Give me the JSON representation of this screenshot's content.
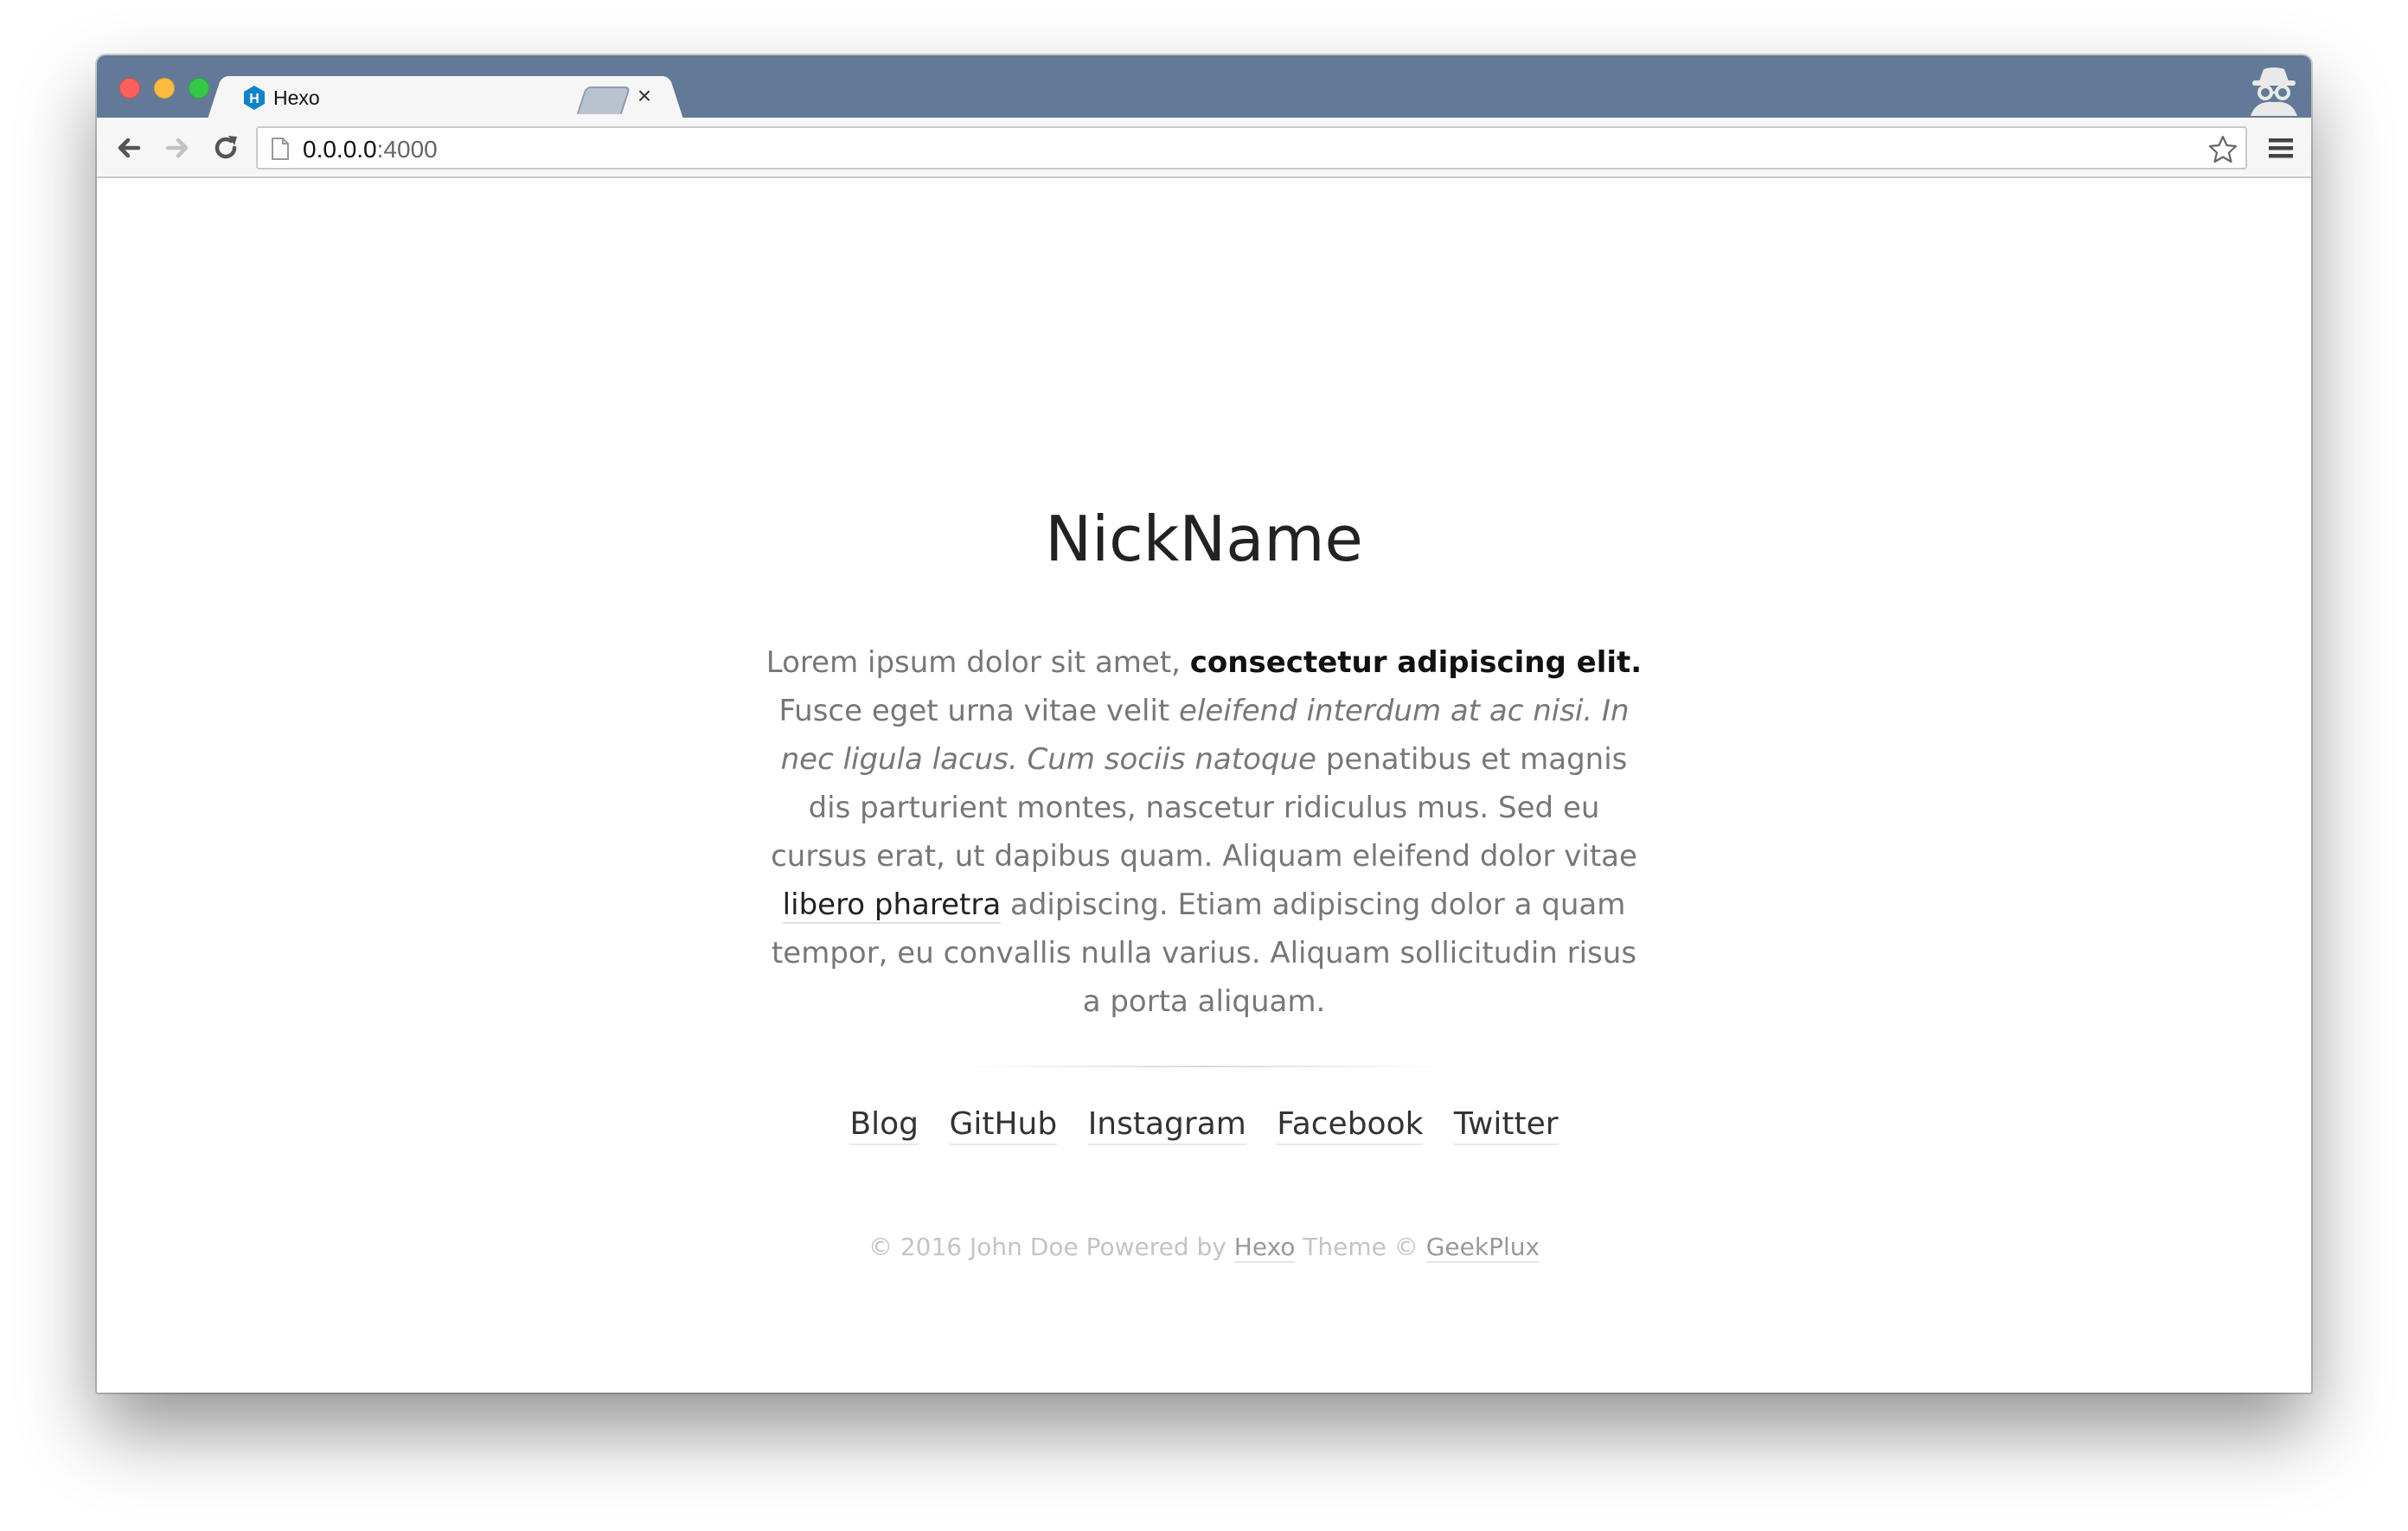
{
  "browser": {
    "tab_title": "Hexo",
    "tab_favicon_letter": "H",
    "tab_close_glyph": "×",
    "url_host": "0.0.0.0",
    "url_port": ":4000",
    "icons": {
      "back": "back-arrow-icon",
      "forward": "forward-arrow-icon",
      "reload": "reload-icon",
      "page": "page-icon",
      "bookmark": "star-icon",
      "menu": "hamburger-menu-icon",
      "incognito": "incognito-icon"
    },
    "colors": {
      "tabstrip": "#627a97",
      "favicon": "#0e83cd"
    }
  },
  "profile": {
    "nickname": "NickName",
    "bio": {
      "p1": "Lorem ipsum dolor sit amet, ",
      "strong": "consectetur adipiscing elit.",
      "p2": " Fusce eget urna vitae velit ",
      "em": "eleifend interdum at ac nisi. In nec ligula lacus. Cum sociis natoque",
      "p3": " penatibus et magnis dis parturient montes, nascetur ridiculus mus. Sed eu cursus erat, ut dapibus quam. Aliquam eleifend dolor vitae ",
      "link": "libero pharetra",
      "p4": " adipiscing. Etiam adipiscing dolor a quam tempor, eu convallis nulla varius. Aliquam sollicitudin risus a porta aliquam."
    },
    "links": [
      {
        "label": "Blog"
      },
      {
        "label": "GitHub"
      },
      {
        "label": "Instagram"
      },
      {
        "label": "Facebook"
      },
      {
        "label": "Twitter"
      }
    ]
  },
  "footer": {
    "copyright": "© 2016 John Doe Powered by ",
    "hexo_link": "Hexo",
    "theme_text": " Theme © ",
    "geekplux_link": "GeekPlux"
  }
}
